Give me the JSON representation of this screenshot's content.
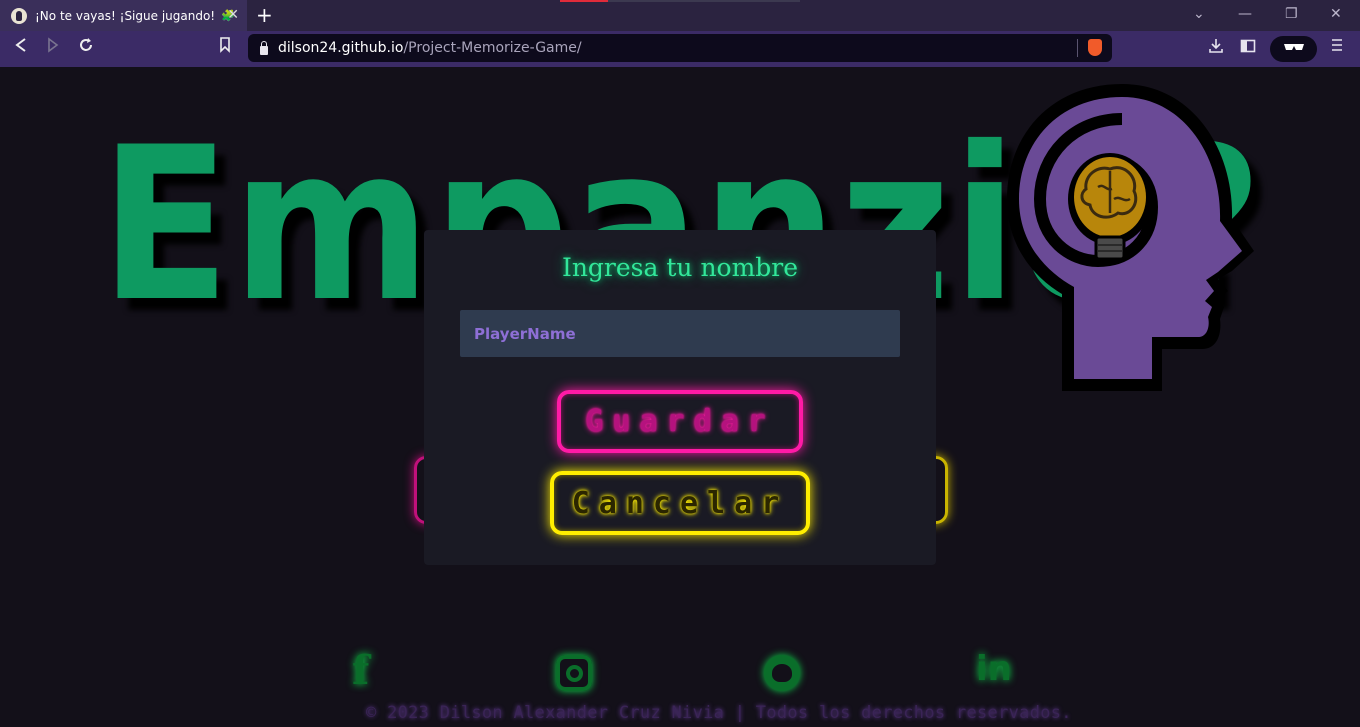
{
  "browser": {
    "tab": {
      "title": "¡No te vayas! ¡Sigue jugando!",
      "emoji": "🧩"
    },
    "newtab": "+",
    "url_host": "dilson24.github.io",
    "url_path": "/Project-Memorize-Game/",
    "window": {
      "chevron": "⌄",
      "minimize": "—",
      "restore": "❐",
      "close": "✕"
    }
  },
  "page": {
    "logo_text": "Empanzio?",
    "modal": {
      "title": "Ingresa tu nombre",
      "input_placeholder": "PlayerName",
      "save_label": "Guardar",
      "cancel_label": "Cancelar"
    },
    "social": {
      "facebook": "f",
      "linkedin": "in"
    },
    "copyright": "© 2023 Dilson Alexander Cruz Nivia | Todos los derechos reservados."
  },
  "colors": {
    "background": "#131019",
    "logo_green": "#0e9a61",
    "modal_bg": "#1a1a24",
    "title_green": "#32e79a",
    "input_bg": "#2f3b4f",
    "placeholder_purple": "#8e6fd6",
    "neon_pink": "#ff1aa6",
    "neon_yellow": "#ffee00",
    "head_purple": "#6a4a96",
    "bulb_gold": "#b8860b"
  },
  "icons": {
    "back": "arrow-left-icon",
    "forward": "arrow-right-icon",
    "reload": "reload-icon",
    "bookmark": "bookmark-icon",
    "lock": "lock-icon",
    "brave": "brave-shield-icon",
    "download": "download-icon",
    "sidebar": "sidebar-icon",
    "private": "glasses-icon",
    "menu": "hamburger-menu-icon",
    "logo_image": "head-brain-bulb-icon"
  }
}
